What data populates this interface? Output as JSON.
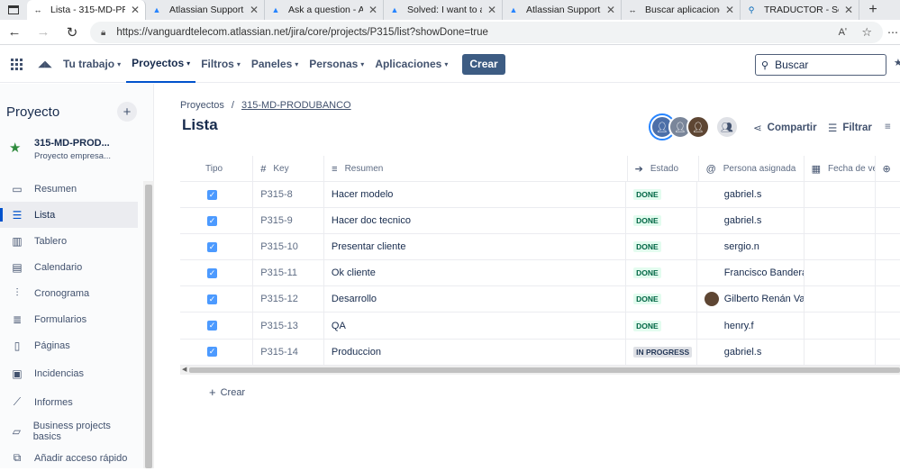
{
  "browser": {
    "tabs": [
      {
        "title": "Lista - 315-MD-PROD",
        "icon": "jira-icon",
        "active": true
      },
      {
        "title": "Atlassian Support",
        "icon": "atlassian-icon"
      },
      {
        "title": "Ask a question - Atlas",
        "icon": "atlassian-icon"
      },
      {
        "title": "Solved: I want to add",
        "icon": "atlassian-icon"
      },
      {
        "title": "Atlassian Support",
        "icon": "atlassian-icon"
      },
      {
        "title": "Buscar aplicaciones n",
        "icon": "page-icon"
      },
      {
        "title": "TRADUCTOR - Search",
        "icon": "search-icon"
      }
    ],
    "url": "https://vanguardtelecom.atlassian.net/jira/core/projects/P315/list?showDone=true",
    "reader_label": "Aʹ"
  },
  "topnav": {
    "menus": [
      {
        "label": "Tu trabajo"
      },
      {
        "label": "Proyectos",
        "active": true
      },
      {
        "label": "Filtros"
      },
      {
        "label": "Paneles"
      },
      {
        "label": "Personas"
      },
      {
        "label": "Aplicaciones"
      }
    ],
    "create_label": "Crear",
    "search_placeholder": "Buscar"
  },
  "sidebar": {
    "heading": "Proyecto",
    "project_name": "315-MD-PROD...",
    "project_type": "Proyecto empresa...",
    "items": [
      {
        "label": "Resumen",
        "icon": "summary-icon"
      },
      {
        "label": "Lista",
        "icon": "list-icon",
        "active": true
      },
      {
        "label": "Tablero",
        "icon": "board-icon"
      },
      {
        "label": "Calendario",
        "icon": "calendar-icon"
      },
      {
        "label": "Cronograma",
        "icon": "timeline-icon"
      },
      {
        "label": "Formularios",
        "icon": "forms-icon"
      },
      {
        "label": "Páginas",
        "icon": "pages-icon"
      },
      {
        "label": "Incidencias",
        "icon": "issues-icon"
      },
      {
        "label": "Informes",
        "icon": "reports-icon"
      },
      {
        "label": "Business projects basics",
        "icon": "book-icon"
      },
      {
        "label": "Añadir acceso rápido",
        "icon": "add-link-icon"
      }
    ]
  },
  "main": {
    "breadcrumb": {
      "root": "Proyectos",
      "separator": "/",
      "project": "315-MD-PRODUBANCO"
    },
    "title": "Lista",
    "share_label": "Compartir",
    "filter_label": "Filtrar",
    "columns": [
      "Tipo",
      "Key",
      "Resumen",
      "Estado",
      "Persona asignada",
      "Fecha de ve..."
    ],
    "rows": [
      {
        "key": "P315-8",
        "summary": "Hacer modelo",
        "status": "DONE",
        "assignee": "gabriel.s"
      },
      {
        "key": "P315-9",
        "summary": "Hacer doc tecnico",
        "status": "DONE",
        "assignee": "gabriel.s"
      },
      {
        "key": "P315-10",
        "summary": "Presentar cliente",
        "status": "DONE",
        "assignee": "sergio.n"
      },
      {
        "key": "P315-11",
        "summary": "Ok cliente",
        "status": "DONE",
        "assignee": "Francisco Banderas"
      },
      {
        "key": "P315-12",
        "summary": "Desarrollo",
        "status": "DONE",
        "assignee": "Gilberto Renán Vall...",
        "avatar": true
      },
      {
        "key": "P315-13",
        "summary": "QA",
        "status": "DONE",
        "assignee": "henry.f"
      },
      {
        "key": "P315-14",
        "summary": "Produccion",
        "status": "IN PROGRESS",
        "assignee": "gabriel.s"
      }
    ],
    "create_label": "Crear"
  },
  "colors": {
    "accent": "#0052cc",
    "create_button": "#3d5c83",
    "done_bg": "#e3fcef",
    "done_text": "#006644",
    "checkbox": "#4c9aff"
  }
}
